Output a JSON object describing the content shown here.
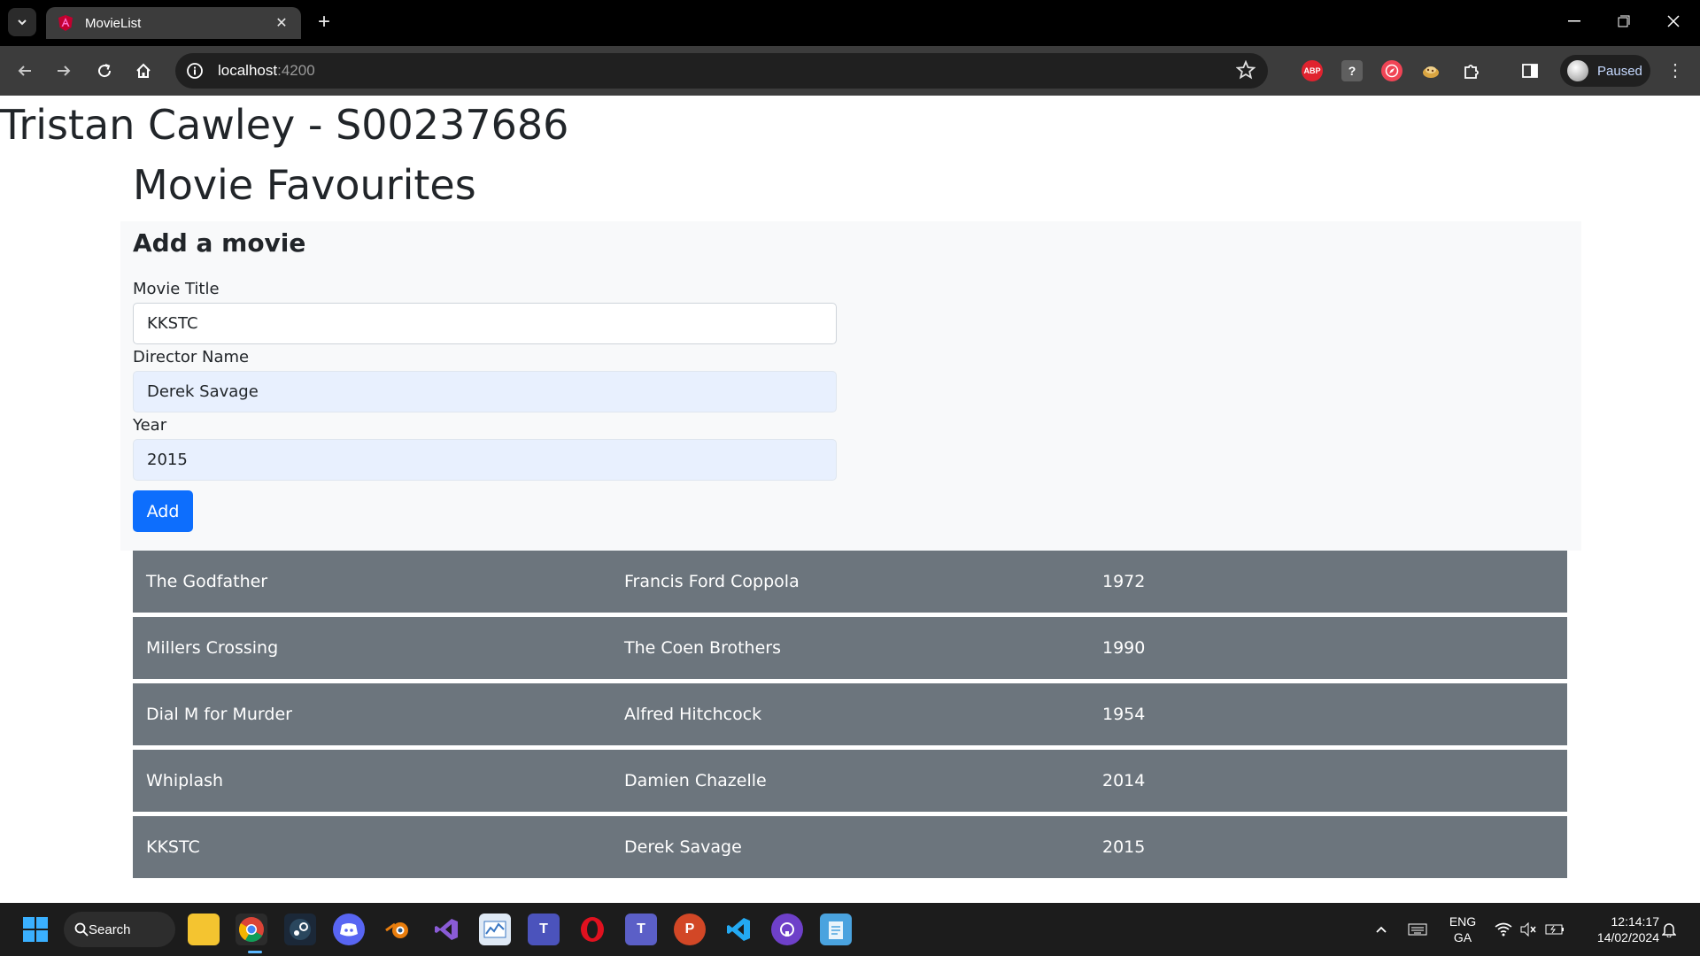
{
  "browser": {
    "tab_title": "MovieList",
    "url_host": "localhost",
    "url_port": ":4200",
    "profile_label": "Paused",
    "extensions": [
      "ABP",
      "?"
    ]
  },
  "page": {
    "student_heading": "Tristan Cawley - S00237686",
    "title": "Movie Favourites",
    "form": {
      "heading": "Add a movie",
      "movie_title_label": "Movie Title",
      "movie_title_value": "KKSTC",
      "director_label": "Director Name",
      "director_value": "Derek Savage",
      "year_label": "Year",
      "year_value": "2015",
      "add_button_label": "Add"
    },
    "movies": [
      {
        "title": "The Godfather",
        "director": "Francis Ford Coppola",
        "year": "1972"
      },
      {
        "title": "Millers Crossing",
        "director": "The Coen Brothers",
        "year": "1990"
      },
      {
        "title": "Dial M for Murder",
        "director": "Alfred Hitchcock",
        "year": "1954"
      },
      {
        "title": "Whiplash",
        "director": "Damien Chazelle",
        "year": "2014"
      },
      {
        "title": "KKSTC",
        "director": "Derek Savage",
        "year": "2015"
      }
    ]
  },
  "taskbar": {
    "search_label": "Search",
    "language_line1": "ENG",
    "language_line2": "GA",
    "time": "12:14:17",
    "date": "14/02/2024"
  },
  "colors": {
    "row_bg": "#6c757d",
    "primary_button": "#0d6efd",
    "form_panel_bg": "#f8f9fa",
    "autofill_bg": "#e8f0fe"
  }
}
